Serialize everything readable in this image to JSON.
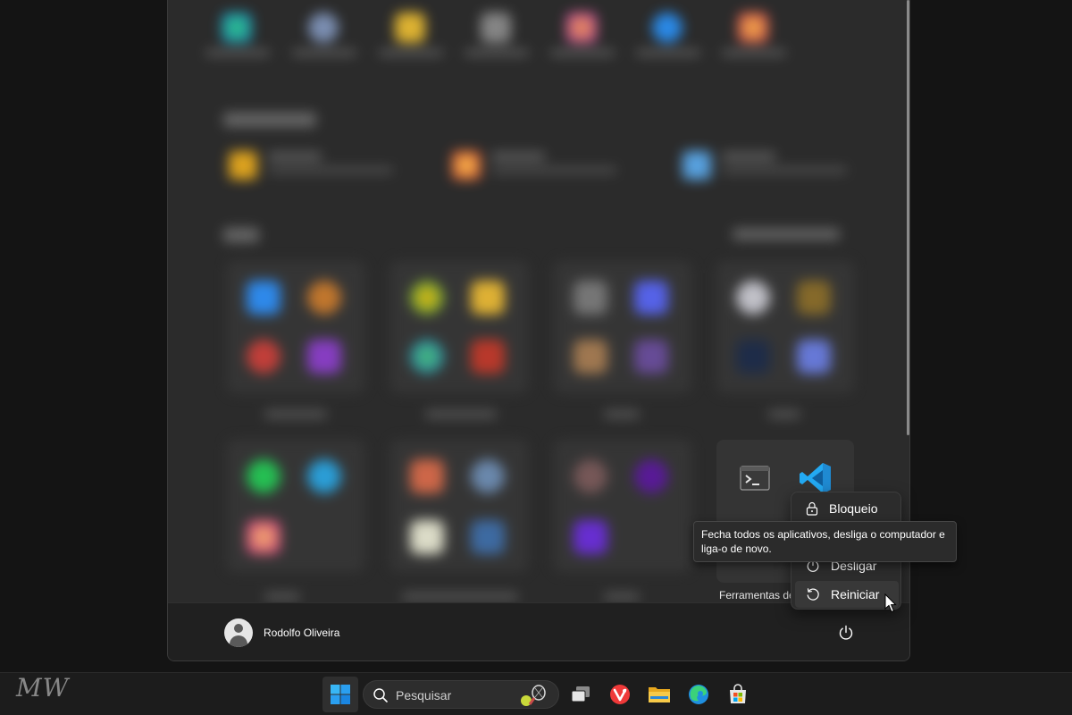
{
  "start_menu": {
    "power_menu": {
      "items": [
        {
          "label": "Bloqueio",
          "icon": "lock-icon"
        },
        {
          "label": "Desligar",
          "icon": "power-icon"
        },
        {
          "label": "Reiniciar",
          "icon": "restart-icon"
        }
      ]
    },
    "tooltip": "Fecha todos os aplicativos, desliga o computador e liga-o de novo.",
    "dev_folder_label": "Ferramentas de",
    "user": {
      "name": "Rodolfo Oliveira",
      "avatar_icon": "user-avatar-icon"
    },
    "power_icon": "power-icon"
  },
  "taskbar": {
    "watermark": "MW",
    "search_placeholder": "Pesquisar",
    "icons": [
      "windows-start-icon",
      "search-icon",
      "task-view-icon",
      "vivaldi-icon",
      "file-explorer-icon",
      "edge-icon",
      "microsoft-store-icon"
    ]
  },
  "colors": {
    "accent": "#0078d4",
    "vscode_blue": "#23a9f2",
    "menu_bg": "#2b2b2b",
    "taskbar_bg": "#1c1c1c"
  }
}
